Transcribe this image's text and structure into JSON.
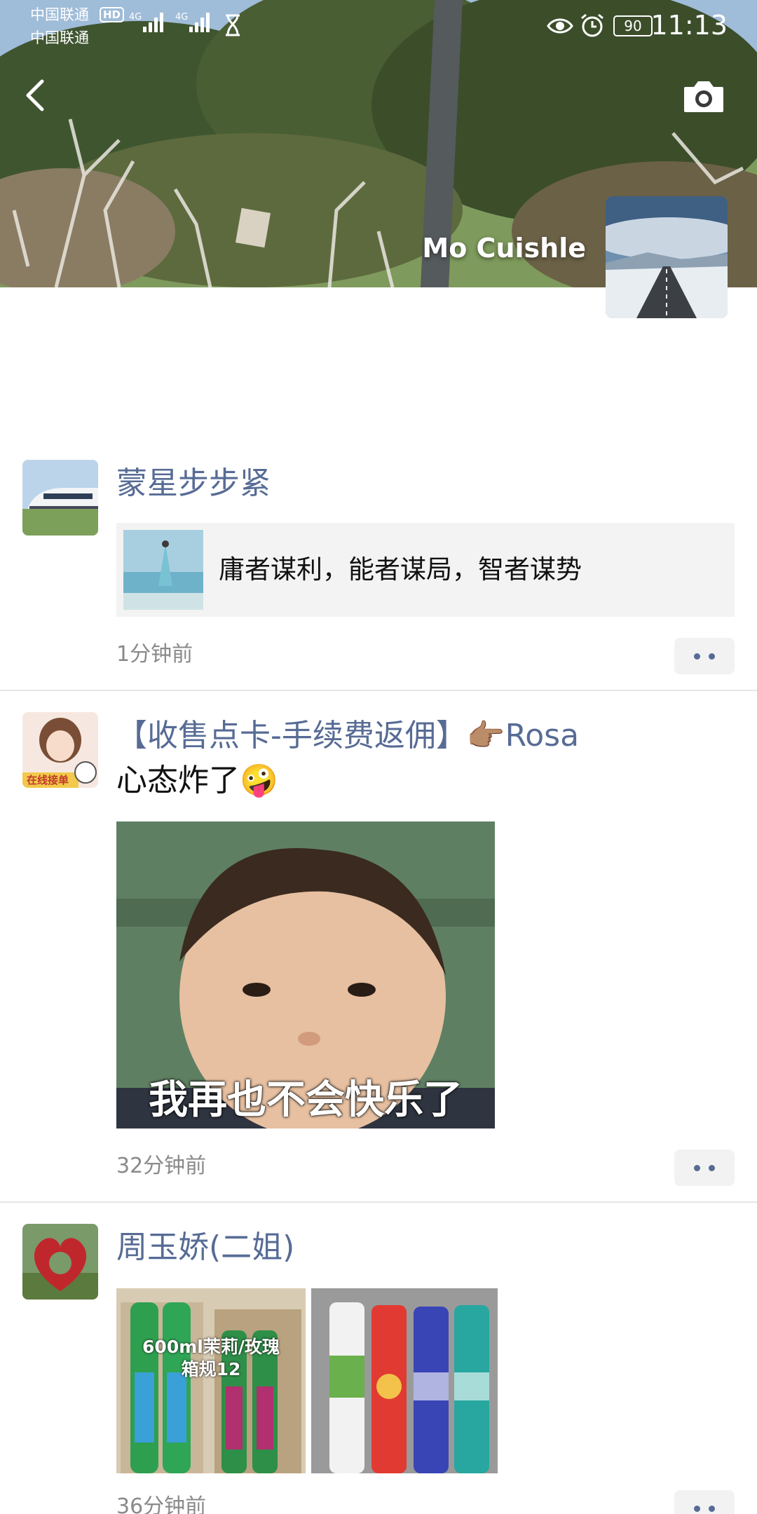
{
  "status_bar": {
    "carrier_1": "中国联通",
    "carrier_2": "中国联通",
    "hd_badge": "HD",
    "network_1": "4G",
    "network_2": "4G",
    "battery": "90",
    "time": "11:13"
  },
  "header": {
    "profile_name": "Mo Cuishle"
  },
  "posts": [
    {
      "author": "蒙星步步紧",
      "share_text": "庸者谋利，能者谋局，智者谋势",
      "time": "1分钟前"
    },
    {
      "author": "【收售点卡-手续费返佣】👉🏽Rosa",
      "text": "心态炸了🤪",
      "avatar_badge": "在线接单",
      "image_caption": "我再也不会快乐了",
      "time": "32分钟前"
    },
    {
      "author": "周玉娇(二姐)",
      "image_1_caption_1": "600ml茉莉/玫瑰",
      "image_1_caption_2": "箱规12",
      "time": "36分钟前"
    }
  ],
  "colors": {
    "author_link": "#576b95",
    "timestamp": "#8a8a8a",
    "share_card_bg": "#f3f3f3"
  },
  "icons": [
    "back-icon",
    "camera-icon",
    "more-icon",
    "eye-icon",
    "alarm-icon",
    "battery-icon",
    "signal-icon",
    "hourglass-icon"
  ]
}
